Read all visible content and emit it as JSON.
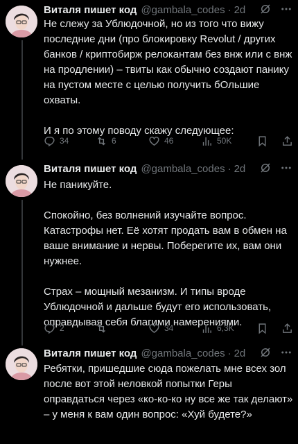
{
  "tweets": [
    {
      "author": "Виталя пишет код",
      "handle": "@gambala_codes",
      "dot": "·",
      "time": "2d",
      "text": "Не слежу за Ублюдочной, но из того что вижу последние дни (про блокировку Revolut / других банков / криптобирж релокантам без внж или с внж на продлении) – твиты как обычно создают панику на пустом месте с целью получить бОльшие охваты.\n\nИ я по этому поводу скажу следующее:",
      "replies": "34",
      "reposts": "6",
      "likes": "46",
      "views": "50K",
      "icons": {
        "head": [
          "grok-icon",
          "more-icon"
        ],
        "actions": [
          "reply-icon",
          "repost-icon",
          "like-icon",
          "views-icon",
          "bookmark-icon",
          "share-icon"
        ]
      }
    },
    {
      "author": "Виталя пишет код",
      "handle": "@gambala_codes",
      "dot": "·",
      "time": "2d",
      "text": "Не паникуйте.\n\nСпокойно, без волнений изучайте вопрос. Катастрофы нет. Её хотят продать вам в обмен на ваше внимание и нервы. Поберегите их, вам они нужнее.\n\nСтрах – мощный мезанизм. И типы вроде Ублюдочной и дальше будут его использовать, оправдывая себя благими намерениями.",
      "replies": "2",
      "reposts": "",
      "likes": "34",
      "views": "6,3K"
    },
    {
      "author": "Виталя пишет код",
      "handle": "@gambala_codes",
      "dot": "·",
      "time": "2d",
      "text": "Ребятки, пришедшие сюда пожелать мне всех зол после вот этой неловкой попытки Геры оправдаться через «ко-ко-ко ну все же так делают» – у меня к вам один вопрос: «Хуй будете?»"
    }
  ]
}
